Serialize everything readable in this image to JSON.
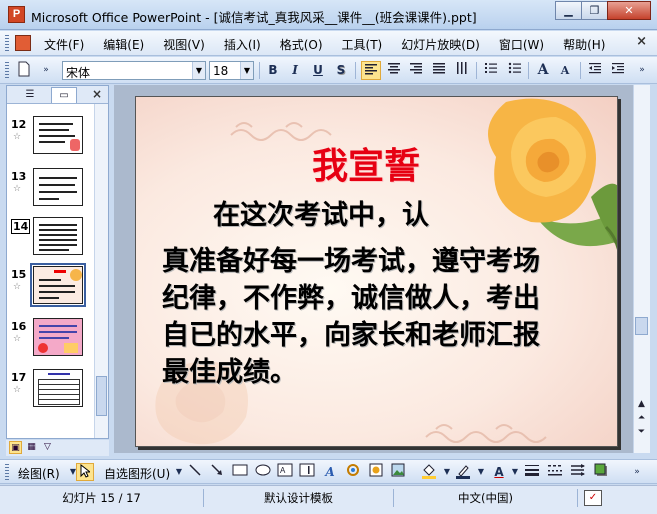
{
  "window": {
    "title": "Microsoft Office PowerPoint - [诚信考试_真我风采__课件__(班会课课件).ppt]",
    "app_icon_letter": "P",
    "buttons": {
      "minimize": "▁",
      "restore": "❐",
      "close": "✕"
    }
  },
  "menubar": {
    "items": [
      {
        "label": "文件(F)"
      },
      {
        "label": "编辑(E)"
      },
      {
        "label": "视图(V)"
      },
      {
        "label": "插入(I)"
      },
      {
        "label": "格式(O)"
      },
      {
        "label": "工具(T)"
      },
      {
        "label": "幻灯片放映(D)"
      },
      {
        "label": "窗口(W)"
      },
      {
        "label": "帮助(H)"
      }
    ],
    "close_doc": "×"
  },
  "toolbar": {
    "font_name": "宋体",
    "font_size": "18",
    "bold": "B",
    "italic": "I",
    "underline": "U",
    "shadow": "S",
    "increase_font": "A",
    "decrease_font": "A"
  },
  "left_pane": {
    "tab_outline_icon": "☰",
    "tab_slides_icon": "▭",
    "close": "×",
    "thumbnails": [
      {
        "number": "12"
      },
      {
        "number": "13"
      },
      {
        "number": "14"
      },
      {
        "number": "15"
      },
      {
        "number": "16"
      },
      {
        "number": "17"
      }
    ],
    "selected_thumbnail": "15"
  },
  "slide": {
    "title": "我宣誓",
    "lines": [
      "在这次考试中，认",
      "真准备好每一场考试，遵守考场",
      "纪律，不作弊，诚信做人，考出",
      "自已的水平，向家长和老师汇报",
      "最佳成绩。"
    ]
  },
  "drawbar": {
    "draw_label": "绘图(R)",
    "autoshapes_label": "自选图形(U)"
  },
  "statusbar": {
    "slide_info": "幻灯片 15 / 17",
    "design": "默认设计模板",
    "language": "中文(中国)"
  }
}
